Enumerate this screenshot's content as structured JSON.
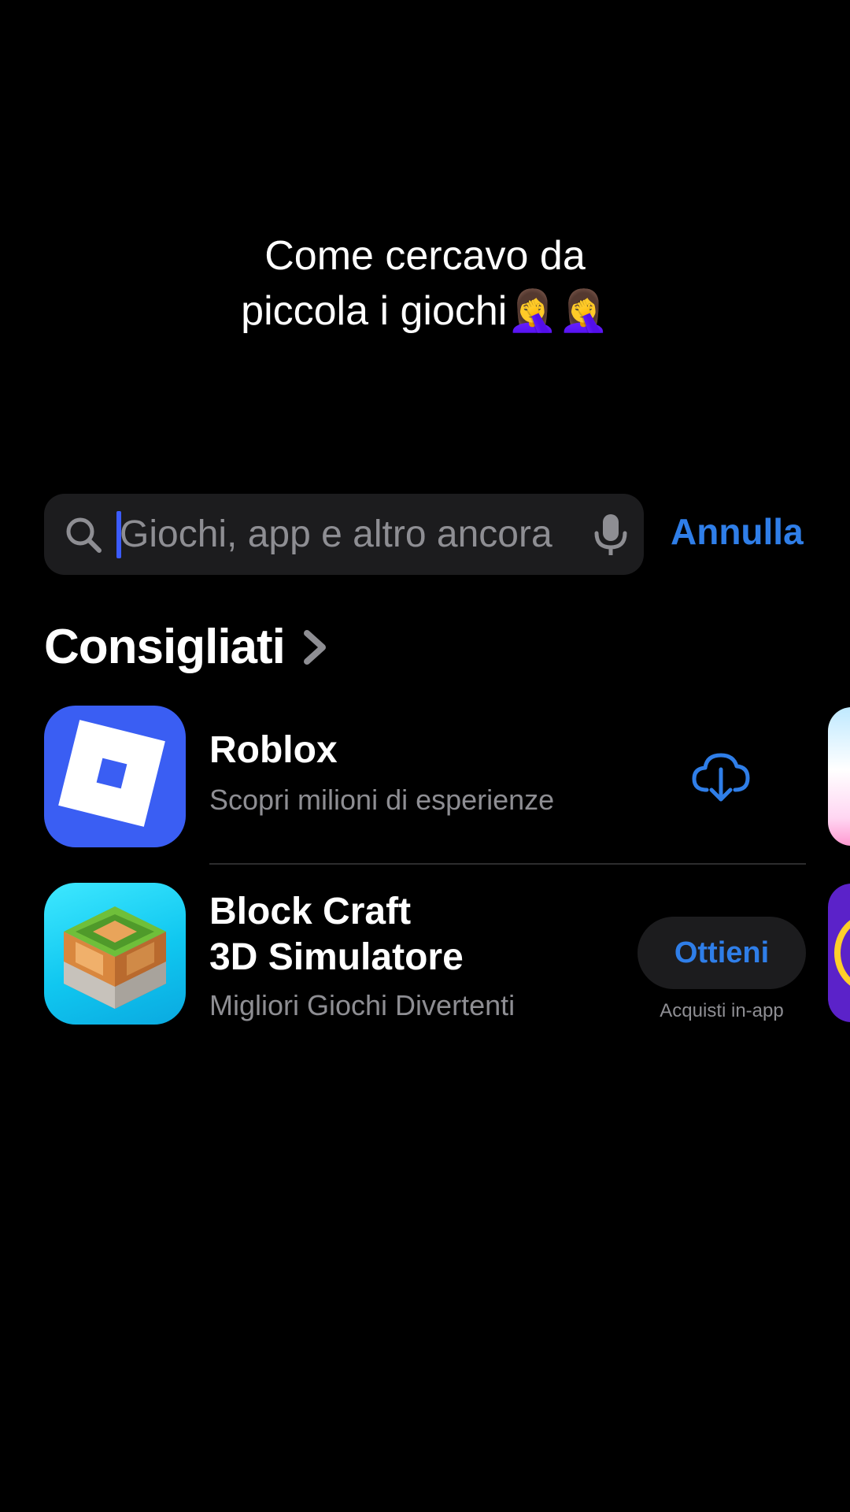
{
  "caption": {
    "line1": "Come cercavo da",
    "line2": "piccola i giochi🤦‍♀️🤦‍♀️"
  },
  "search": {
    "placeholder": "Giochi, app e altro ancora",
    "value": "",
    "cancel_label": "Annulla"
  },
  "section": {
    "title": "Consigliati"
  },
  "apps": [
    {
      "name": "Roblox",
      "subtitle": "Scopri milioni di esperienze",
      "action": "download-cloud-icon"
    },
    {
      "name_line1": "Block Craft",
      "name_line2": "3D Simulatore",
      "subtitle": "Migliori Giochi Divertenti",
      "button_label": "Ottieni",
      "note": "Acquisti in-app"
    }
  ],
  "colors": {
    "background": "#000000",
    "accent": "#2f7ee8",
    "search_bg": "#1c1c1e",
    "secondary_text": "#8e8e93",
    "roblox_blue": "#3a5ef3"
  }
}
